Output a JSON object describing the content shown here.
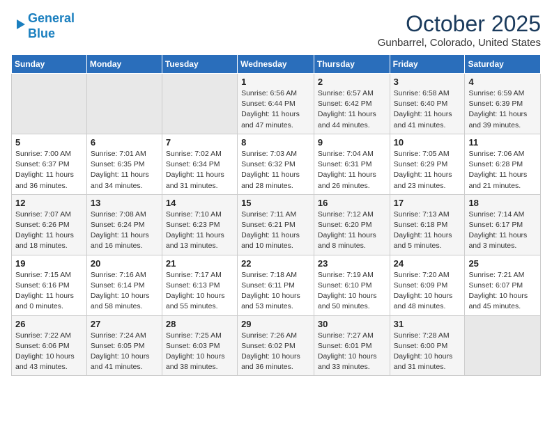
{
  "header": {
    "logo_line1": "General",
    "logo_line2": "Blue",
    "month_title": "October 2025",
    "subtitle": "Gunbarrel, Colorado, United States"
  },
  "weekdays": [
    "Sunday",
    "Monday",
    "Tuesday",
    "Wednesday",
    "Thursday",
    "Friday",
    "Saturday"
  ],
  "weeks": [
    [
      {
        "day": "",
        "info": ""
      },
      {
        "day": "",
        "info": ""
      },
      {
        "day": "",
        "info": ""
      },
      {
        "day": "1",
        "info": "Sunrise: 6:56 AM\nSunset: 6:44 PM\nDaylight: 11 hours\nand 47 minutes."
      },
      {
        "day": "2",
        "info": "Sunrise: 6:57 AM\nSunset: 6:42 PM\nDaylight: 11 hours\nand 44 minutes."
      },
      {
        "day": "3",
        "info": "Sunrise: 6:58 AM\nSunset: 6:40 PM\nDaylight: 11 hours\nand 41 minutes."
      },
      {
        "day": "4",
        "info": "Sunrise: 6:59 AM\nSunset: 6:39 PM\nDaylight: 11 hours\nand 39 minutes."
      }
    ],
    [
      {
        "day": "5",
        "info": "Sunrise: 7:00 AM\nSunset: 6:37 PM\nDaylight: 11 hours\nand 36 minutes."
      },
      {
        "day": "6",
        "info": "Sunrise: 7:01 AM\nSunset: 6:35 PM\nDaylight: 11 hours\nand 34 minutes."
      },
      {
        "day": "7",
        "info": "Sunrise: 7:02 AM\nSunset: 6:34 PM\nDaylight: 11 hours\nand 31 minutes."
      },
      {
        "day": "8",
        "info": "Sunrise: 7:03 AM\nSunset: 6:32 PM\nDaylight: 11 hours\nand 28 minutes."
      },
      {
        "day": "9",
        "info": "Sunrise: 7:04 AM\nSunset: 6:31 PM\nDaylight: 11 hours\nand 26 minutes."
      },
      {
        "day": "10",
        "info": "Sunrise: 7:05 AM\nSunset: 6:29 PM\nDaylight: 11 hours\nand 23 minutes."
      },
      {
        "day": "11",
        "info": "Sunrise: 7:06 AM\nSunset: 6:28 PM\nDaylight: 11 hours\nand 21 minutes."
      }
    ],
    [
      {
        "day": "12",
        "info": "Sunrise: 7:07 AM\nSunset: 6:26 PM\nDaylight: 11 hours\nand 18 minutes."
      },
      {
        "day": "13",
        "info": "Sunrise: 7:08 AM\nSunset: 6:24 PM\nDaylight: 11 hours\nand 16 minutes."
      },
      {
        "day": "14",
        "info": "Sunrise: 7:10 AM\nSunset: 6:23 PM\nDaylight: 11 hours\nand 13 minutes."
      },
      {
        "day": "15",
        "info": "Sunrise: 7:11 AM\nSunset: 6:21 PM\nDaylight: 11 hours\nand 10 minutes."
      },
      {
        "day": "16",
        "info": "Sunrise: 7:12 AM\nSunset: 6:20 PM\nDaylight: 11 hours\nand 8 minutes."
      },
      {
        "day": "17",
        "info": "Sunrise: 7:13 AM\nSunset: 6:18 PM\nDaylight: 11 hours\nand 5 minutes."
      },
      {
        "day": "18",
        "info": "Sunrise: 7:14 AM\nSunset: 6:17 PM\nDaylight: 11 hours\nand 3 minutes."
      }
    ],
    [
      {
        "day": "19",
        "info": "Sunrise: 7:15 AM\nSunset: 6:16 PM\nDaylight: 11 hours\nand 0 minutes."
      },
      {
        "day": "20",
        "info": "Sunrise: 7:16 AM\nSunset: 6:14 PM\nDaylight: 10 hours\nand 58 minutes."
      },
      {
        "day": "21",
        "info": "Sunrise: 7:17 AM\nSunset: 6:13 PM\nDaylight: 10 hours\nand 55 minutes."
      },
      {
        "day": "22",
        "info": "Sunrise: 7:18 AM\nSunset: 6:11 PM\nDaylight: 10 hours\nand 53 minutes."
      },
      {
        "day": "23",
        "info": "Sunrise: 7:19 AM\nSunset: 6:10 PM\nDaylight: 10 hours\nand 50 minutes."
      },
      {
        "day": "24",
        "info": "Sunrise: 7:20 AM\nSunset: 6:09 PM\nDaylight: 10 hours\nand 48 minutes."
      },
      {
        "day": "25",
        "info": "Sunrise: 7:21 AM\nSunset: 6:07 PM\nDaylight: 10 hours\nand 45 minutes."
      }
    ],
    [
      {
        "day": "26",
        "info": "Sunrise: 7:22 AM\nSunset: 6:06 PM\nDaylight: 10 hours\nand 43 minutes."
      },
      {
        "day": "27",
        "info": "Sunrise: 7:24 AM\nSunset: 6:05 PM\nDaylight: 10 hours\nand 41 minutes."
      },
      {
        "day": "28",
        "info": "Sunrise: 7:25 AM\nSunset: 6:03 PM\nDaylight: 10 hours\nand 38 minutes."
      },
      {
        "day": "29",
        "info": "Sunrise: 7:26 AM\nSunset: 6:02 PM\nDaylight: 10 hours\nand 36 minutes."
      },
      {
        "day": "30",
        "info": "Sunrise: 7:27 AM\nSunset: 6:01 PM\nDaylight: 10 hours\nand 33 minutes."
      },
      {
        "day": "31",
        "info": "Sunrise: 7:28 AM\nSunset: 6:00 PM\nDaylight: 10 hours\nand 31 minutes."
      },
      {
        "day": "",
        "info": ""
      }
    ]
  ]
}
